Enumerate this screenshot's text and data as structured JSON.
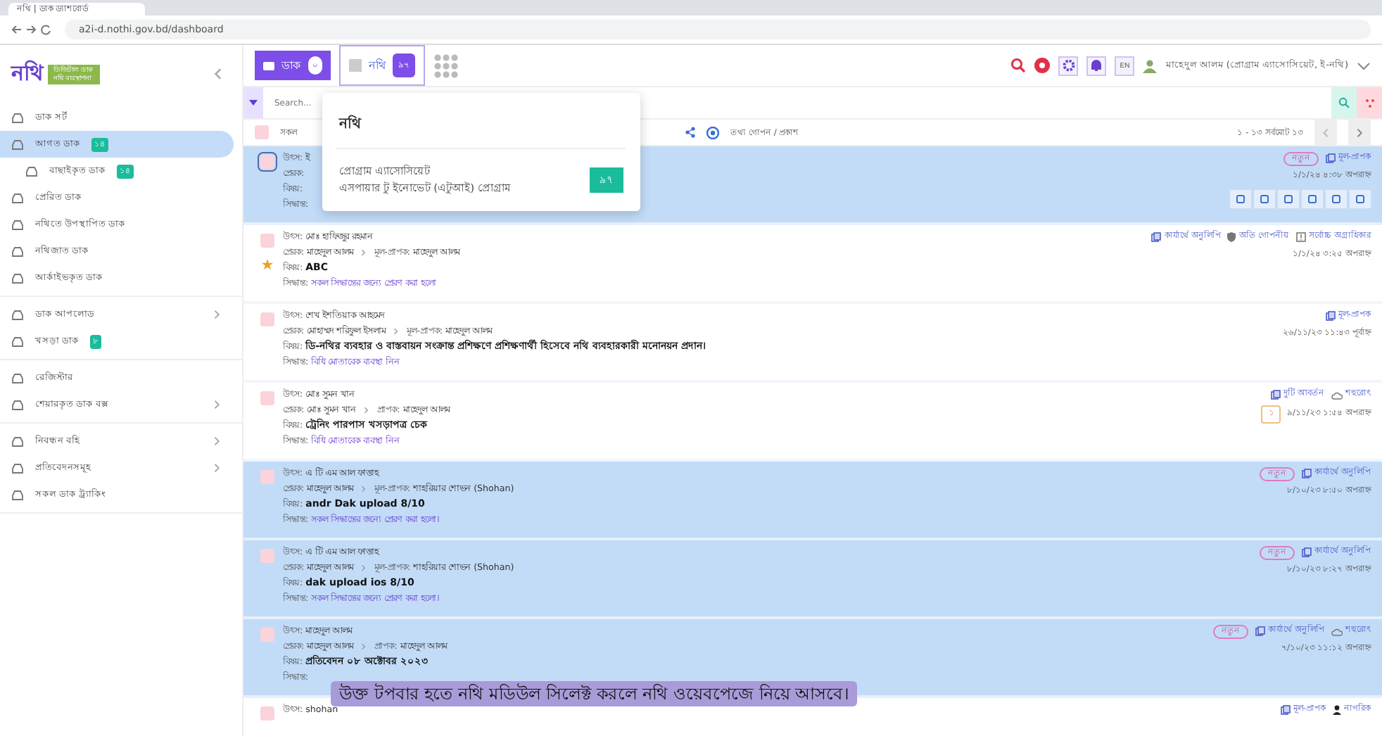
{
  "browser": {
    "tab_title": "নথি | ডাক ড্যাশবোর্ড",
    "url": "a2i-d.nothi.gov.bd/dashboard"
  },
  "logo": {
    "text": "নথি",
    "tagline": [
      "ডিজিটাল ডাক",
      "নথি ব্যবস্থাপনা"
    ]
  },
  "modules": [
    {
      "label": "ডাক",
      "badge": "০",
      "selected": true
    },
    {
      "label": "নথি",
      "badge": "৯৭",
      "selected": false
    }
  ],
  "header": {
    "language": "EN",
    "user": "মাহেদুল আলম (প্রোগ্রাম এ্যাসোসিয়েট, ই-নথি)"
  },
  "sidebar": {
    "groups": [
      [
        {
          "label": "ডাক সর্ট",
          "selected": false,
          "expandable": false
        },
        {
          "label": "আগত ডাক",
          "badge": "১৪",
          "selected": true,
          "expandable": false,
          "children": [
            {
              "label": "বাছাইকৃত ডাক",
              "badge": "১৪",
              "selected": false,
              "expandable": false
            }
          ]
        },
        {
          "label": "প্রেরিত ডাক",
          "selected": false,
          "expandable": false
        },
        {
          "label": "নথিতে উপস্থাপিত ডাক",
          "selected": false,
          "expandable": false
        },
        {
          "label": "নথিজাত ডাক",
          "selected": false,
          "expandable": false
        },
        {
          "label": "আর্কাইভকৃত ডাক",
          "selected": false,
          "expandable": false
        }
      ],
      [
        {
          "label": "ডাক আপলোড",
          "selected": false,
          "expandable": true
        },
        {
          "label": "খসড়া ডাক",
          "badge": "৮",
          "selected": false,
          "expandable": false
        }
      ],
      [
        {
          "label": "রেজিস্টার",
          "selected": false,
          "expandable": false
        },
        {
          "label": "শেয়ারকৃত ডাক বক্স",
          "selected": false,
          "expandable": true
        }
      ],
      [
        {
          "label": "নিবন্ধন বহি",
          "selected": false,
          "expandable": true
        },
        {
          "label": "প্রতিবেদনসমূহ",
          "selected": false,
          "expandable": true
        },
        {
          "label": "সকল ডাক ট্র্যাকিং",
          "selected": false,
          "expandable": false
        }
      ]
    ]
  },
  "search": {
    "placeholder": "Search..."
  },
  "list_toolbar": {
    "checked": false,
    "select_all": "সকল",
    "visibility": "তথ্য গোপন / প্রকাশ",
    "pagination": "১ - ১৩ সর্বমোট ১৩"
  },
  "popup": {
    "title": "নথি",
    "offices": [
      {
        "role": "প্রোগ্রাম এ্যাসোসিয়েট",
        "office": "এসপায়ার টু ইনোভেট (এটুআই) প্রোগ্রাম",
        "count": "৯৭"
      }
    ]
  },
  "rows": [
    {
      "selected": true,
      "starred": false,
      "source": {
        "label": "উৎস:",
        "text": "ই"
      },
      "sender": {
        "label": "প্রেরক:"
      },
      "subject": {
        "label": "বিষয়:"
      },
      "decision": {
        "label": "সিদ্ধান্ত:"
      },
      "tags": [
        {
          "kind": "new",
          "text": "নতুন"
        },
        {
          "kind": "copy",
          "text": "মূল-প্রাপক"
        }
      ],
      "date": "১/১/২৪ ৪:৩৮ অপরাহ্ন",
      "actions": true
    },
    {
      "selected": false,
      "starred": true,
      "source": {
        "label": "উৎস:",
        "text": "মোঃ হাফিজুর রহমান"
      },
      "sender": {
        "label": "প্রেরক:",
        "text": "মাহেদুল আলম"
      },
      "recipient": {
        "label": "মূল-প্রাপক:",
        "text": "মাহেদুল আলম"
      },
      "subject": {
        "label": "বিষয়:",
        "text": "ABC"
      },
      "decision": {
        "label": "সিদ্ধান্ত:",
        "text": "সকল সিদ্ধান্তের জন্যে প্রেরণ করা হলো"
      },
      "tags": [
        {
          "kind": "copy",
          "text": "কার্যার্থে অনুলিপি"
        },
        {
          "kind": "secret",
          "text": "অতি গোপনীয়"
        },
        {
          "kind": "priority",
          "text": "সর্বোচ্চ অগ্রাধিকার"
        }
      ],
      "date": "১/১/২৪ ৩:২৫ অপরাহ্ন",
      "actions": false
    },
    {
      "selected": false,
      "starred": false,
      "source": {
        "label": "উৎস:",
        "text": "শেখ ইশতিয়াক আহমেদ"
      },
      "sender": {
        "label": "প্রেরক:",
        "text": "মোহাম্মদ শরিফুল ইসলাম"
      },
      "recipient": {
        "label": "মূল-প্রাপক:",
        "text": "মাহেদুল আলম"
      },
      "subject": {
        "label": "বিষয়:",
        "text": "ডি-নথির ব্যবহার ও বাস্তবায়ন সংক্রান্ত প্রশিক্ষণে প্রশিক্ষণার্থী হিসেবে নথি ব্যবহারকারী মনোনয়ন প্রদান।"
      },
      "decision": {
        "label": "সিদ্ধান্ত:",
        "text": "বিধি মোতাবেক ব্যবস্থা নিন"
      },
      "tags": [
        {
          "kind": "copy",
          "text": "মূল-প্রাপক"
        }
      ],
      "date": "২৬/১১/২৩ ১১:৪৩ পূর্বাহ্ন",
      "actions": false
    },
    {
      "selected": false,
      "starred": false,
      "source": {
        "label": "উৎস:",
        "text": "মোঃ সুমন খান"
      },
      "sender": {
        "label": "প্রেরক:",
        "text": "মোঃ সুমন খান"
      },
      "recipient": {
        "label": "প্রাপক:",
        "text": "মাহেদুল আলম"
      },
      "subject": {
        "label": "বিষয়:",
        "text": "ট্রেনিং পারপাস খসড়াপত্র চেক"
      },
      "decision": {
        "label": "সিদ্ধান্ত:",
        "text": "বিধি মোতাবেক ব্যবস্থা নিন"
      },
      "tags": [
        {
          "kind": "copy",
          "text": "দুটি আবর্তন"
        },
        {
          "kind": "cloud",
          "text": "শহুরোৎ"
        }
      ],
      "flag": "১",
      "date": "৯/১১/২৩ ১:৫৪ অপরাহ্ন",
      "actions": false
    },
    {
      "selected": true,
      "starred": false,
      "source": {
        "label": "উৎস:",
        "text": "এ টি এম আল ফাত্তাহ"
      },
      "sender": {
        "label": "প্রেরক:",
        "text": "মাহেদুল আলম"
      },
      "recipient": {
        "label": "মূল-প্রাপক:",
        "text": "শাহরিয়ার শোভন (Shohan)"
      },
      "subject": {
        "label": "বিষয়:",
        "text": "andr Dak upload 8/10"
      },
      "decision": {
        "label": "সিদ্ধান্ত:",
        "text": "সকল সিদ্ধান্তের জন্যে প্রেরণ করা হলো।"
      },
      "tags": [
        {
          "kind": "new",
          "text": "নতুন"
        },
        {
          "kind": "copy",
          "text": "কার্যার্থে অনুলিপি"
        }
      ],
      "date": "৮/১০/২৩ ৮:৫০ অপরাহ্ন",
      "actions": false
    },
    {
      "selected": true,
      "starred": false,
      "source": {
        "label": "উৎস:",
        "text": "এ টি এম আল ফাত্তাহ"
      },
      "sender": {
        "label": "প্রেরক:",
        "text": "মাহেদুল আলম"
      },
      "recipient": {
        "label": "মূল-প্রাপক:",
        "text": "শাহরিয়ার শোভন (Shohan)"
      },
      "subject": {
        "label": "বিষয়:",
        "text": "dak upload ios 8/10"
      },
      "decision": {
        "label": "সিদ্ধান্ত:",
        "text": "সকল সিদ্ধান্তের জন্যে প্রেরণ করা হলো।"
      },
      "tags": [
        {
          "kind": "new",
          "text": "নতুন"
        },
        {
          "kind": "copy",
          "text": "কার্যার্থে অনুলিপি"
        }
      ],
      "date": "৮/১০/২৩ ৮:২৭ অপরাহ্ন",
      "actions": false
    },
    {
      "selected": true,
      "starred": false,
      "source": {
        "label": "উৎস:",
        "text": "মাহেদুল আলম"
      },
      "sender": {
        "label": "প্রেরক:",
        "text": "মাহেদুল আলম"
      },
      "recipient": {
        "label": "প্রাপক:",
        "text": "মাহেদুল আলম"
      },
      "subject": {
        "label": "বিষয়:",
        "text": "প্রতিবেদন ০৮ অক্টোবর ২০২৩"
      },
      "decision": {
        "label": "সিদ্ধান্ত:"
      },
      "tags": [
        {
          "kind": "new",
          "text": "নতুন"
        },
        {
          "kind": "copy",
          "text": "কার্যার্থে অনুলিপি"
        },
        {
          "kind": "cloud",
          "text": "শহুরোৎ"
        }
      ],
      "date": "৭/১০/২৩ ১১:১২ অপরাহ্ন",
      "actions": false
    },
    {
      "selected": false,
      "starred": false,
      "source": {
        "label": "উৎস:",
        "text": "shohan"
      },
      "tags": [
        {
          "kind": "copy",
          "text": "মূল-প্রাপক"
        },
        {
          "kind": "person",
          "text": "নাগরিক"
        }
      ],
      "actions": false
    }
  ],
  "caption": "উক্ত টপবার হতে নথি মডিউল সিলেক্ট করলে নথি ওয়েবপেজে নিয়ে আসবে।"
}
